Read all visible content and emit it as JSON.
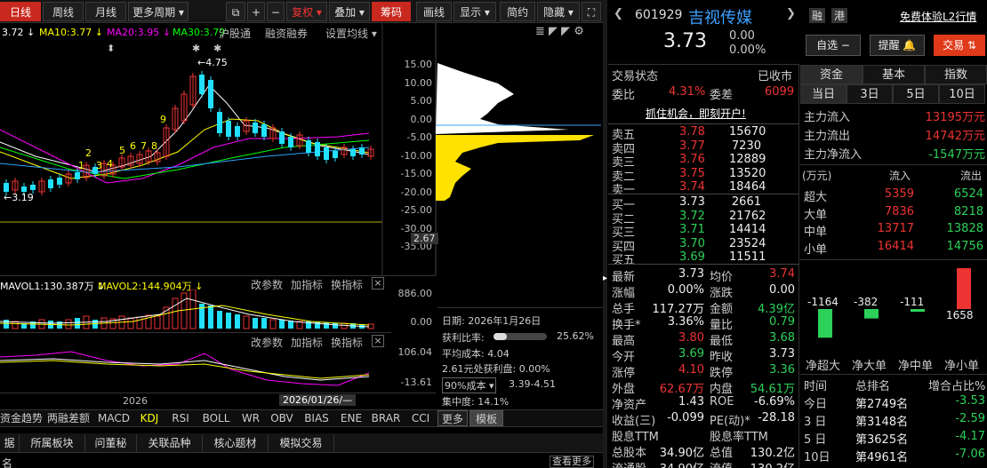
{
  "toolbar": {
    "period_tabs": [
      "日线",
      "周线",
      "月线",
      "更多周期 ▾"
    ],
    "plus": "+",
    "minus": "−",
    "fuquan": "复权 ▾",
    "overlay": "叠加 ▾",
    "chouma": "筹码",
    "draw": "画线",
    "display": "显示 ▾",
    "simple": "简约",
    "hide": "隐藏 ▾"
  },
  "ma": {
    "ma5": "3.72 ↓",
    "ma10": "MA10:3.77 ↓",
    "ma20": "MA20:3.95 ↓",
    "ma30": "MA30:3.79"
  },
  "chart_links": {
    "hugutong": "沪股通",
    "rzrq": "融资融券",
    "setma": "设置均线 ▾"
  },
  "price_axis": [
    "15.00",
    "10.00",
    "5.00",
    "0.00",
    "-5.00",
    "-10.00",
    "-15.00",
    "-20.00",
    "-25.00",
    "-30.00",
    "-35.00"
  ],
  "price_marker": "2.67",
  "annotations": {
    "high": "4.75",
    "low": "3.19",
    "count_labels": [
      "1",
      "2",
      "3",
      "4",
      "5",
      "6",
      "7",
      "8",
      "9"
    ]
  },
  "vol": {
    "mavol1": "MAVOL1:130.387万 ↓",
    "mavol2": "MAVOL2:144.904万 ↓",
    "edit": "改参数",
    "add": "加指标",
    "switch": "换指标",
    "axis_top": "886.00",
    "axis_bot": "0.00"
  },
  "kdj": {
    "edit": "改参数",
    "add": "加指标",
    "switch": "换指标",
    "axis_top": "106.04",
    "axis_bot": "-13.61"
  },
  "date_axis": {
    "year": "2026",
    "cursor": "2026/01/26/—"
  },
  "chip": {
    "date": "日期: 2026年1月26日",
    "profit_label": "获利比率:",
    "profit_val": "25.62%",
    "avg_cost": "平均成本: 4.04",
    "profit_at": "2.61元处获利盘: 0.00%",
    "cost_sel": "90%成本 ▾",
    "cost_range": "3.39-4.51",
    "concentration": "集中度: 14.1%"
  },
  "ind_tabs": [
    "资金趋势",
    "两融差额",
    "MACD",
    "KDJ",
    "RSI",
    "BOLL",
    "WR",
    "OBV",
    "BIAS",
    "ENE",
    "BRAR",
    "CCI",
    "更多",
    "模板"
  ],
  "bottom_tabs": [
    "据",
    "所属板块",
    "问董秘",
    "关联品种",
    "核心题材",
    "模拟交易"
  ],
  "bottom_more": "查看更多",
  "bottom_row": "名",
  "stock": {
    "code": "601929",
    "name": "吉视传媒",
    "price": "3.73",
    "change": "0.00",
    "pct": "0.00%",
    "badge_rong": "融",
    "badge_gang": "港",
    "l2": "免费体验L2行情",
    "zixuan": "自选 −",
    "remind": "提醒 🔔",
    "trade": "交易 ⇅"
  },
  "status": {
    "label": "交易状态",
    "val": "已收市",
    "weibi_l": "委比",
    "weibi": "4.31%",
    "weicha_l": "委差",
    "weicha": "6099",
    "promo": "抓住机会，即刻开户!"
  },
  "orderbook": {
    "asks": [
      {
        "l": "卖五",
        "p": "3.78",
        "v": "15670"
      },
      {
        "l": "卖四",
        "p": "3.77",
        "v": "7230"
      },
      {
        "l": "卖三",
        "p": "3.76",
        "v": "12889"
      },
      {
        "l": "卖二",
        "p": "3.75",
        "v": "13520"
      },
      {
        "l": "卖一",
        "p": "3.74",
        "v": "18464"
      }
    ],
    "bids": [
      {
        "l": "买一",
        "p": "3.73",
        "v": "2661"
      },
      {
        "l": "买二",
        "p": "3.72",
        "v": "21762"
      },
      {
        "l": "买三",
        "p": "3.71",
        "v": "14414"
      },
      {
        "l": "买四",
        "p": "3.70",
        "v": "23524"
      },
      {
        "l": "买五",
        "p": "3.69",
        "v": "11511"
      }
    ]
  },
  "quote": [
    {
      "l1": "最新",
      "v1": "3.73",
      "l2": "均价",
      "v2": "3.74"
    },
    {
      "l1": "涨幅",
      "v1": "0.00%",
      "l2": "涨跌",
      "v2": "0.00"
    },
    {
      "l1": "总手",
      "v1": "117.27万",
      "l2": "金额",
      "v2": "4.39亿"
    },
    {
      "l1": "换手*",
      "v1": "3.36%",
      "l2": "量比",
      "v2": "0.79"
    },
    {
      "l1": "最高",
      "v1": "3.80",
      "l2": "最低",
      "v2": "3.68"
    },
    {
      "l1": "今开",
      "v1": "3.69",
      "l2": "昨收",
      "v2": "3.73"
    },
    {
      "l1": "涨停",
      "v1": "4.10",
      "l2": "跌停",
      "v2": "3.36"
    },
    {
      "l1": "外盘",
      "v1": "62.67万",
      "l2": "内盘",
      "v2": "54.61万"
    },
    {
      "l1": "净资产",
      "v1": "1.43",
      "l2": "ROE",
      "v2": "-6.69%"
    },
    {
      "l1": "收益(三)",
      "v1": "-0.099",
      "l2": "PE(动)*",
      "v2": "-28.18"
    },
    {
      "l1": "股息TTM",
      "v1": "",
      "l2": "股息率TTM",
      "v2": ""
    },
    {
      "l1": "总股本",
      "v1": "34.90亿",
      "l2": "总值",
      "v2": "130.2亿"
    },
    {
      "l1": "流通股",
      "v1": "34.90亿",
      "l2": "流值",
      "v2": "130.2亿"
    }
  ],
  "fund": {
    "tabs": [
      "资金",
      "基本",
      "指数"
    ],
    "periods": [
      "当日",
      "3日",
      "5日",
      "10日"
    ],
    "flow": [
      {
        "l": "主力流入",
        "v": "13195万元"
      },
      {
        "l": "主力流出",
        "v": "14742万元"
      },
      {
        "l": "主力净流入",
        "v": "-1547万元"
      }
    ],
    "head": {
      "unit": "(万元)",
      "in": "流入",
      "out": "流出"
    },
    "rows": [
      {
        "l": "超大",
        "in": "5359",
        "out": "6524"
      },
      {
        "l": "大单",
        "in": "7836",
        "out": "8218"
      },
      {
        "l": "中单",
        "in": "13717",
        "out": "13828"
      },
      {
        "l": "小单",
        "in": "16414",
        "out": "14756"
      }
    ],
    "net": [
      {
        "l": "净超大",
        "v": "-1164",
        "n": -1164
      },
      {
        "l": "净大单",
        "v": "-382",
        "n": -382
      },
      {
        "l": "净中单",
        "v": "-111",
        "n": -111
      },
      {
        "l": "净小单",
        "v": "1658",
        "n": 1658
      }
    ],
    "rank_head": {
      "t": "时间",
      "r": "总排名",
      "c": "增合占比%"
    },
    "rank": [
      {
        "t": "今日",
        "r": "第2749名",
        "c": "-3.53"
      },
      {
        "t": "3 日",
        "r": "第3148名",
        "c": "-2.59"
      },
      {
        "t": "5 日",
        "r": "第3625名",
        "c": "-4.17"
      },
      {
        "t": "10日",
        "r": "第4961名",
        "c": "-7.06"
      }
    ]
  },
  "colors": {
    "up": "#e33",
    "down": "#2dd15a",
    "accent": "#c8281e",
    "blue": "#3aa0ff"
  }
}
